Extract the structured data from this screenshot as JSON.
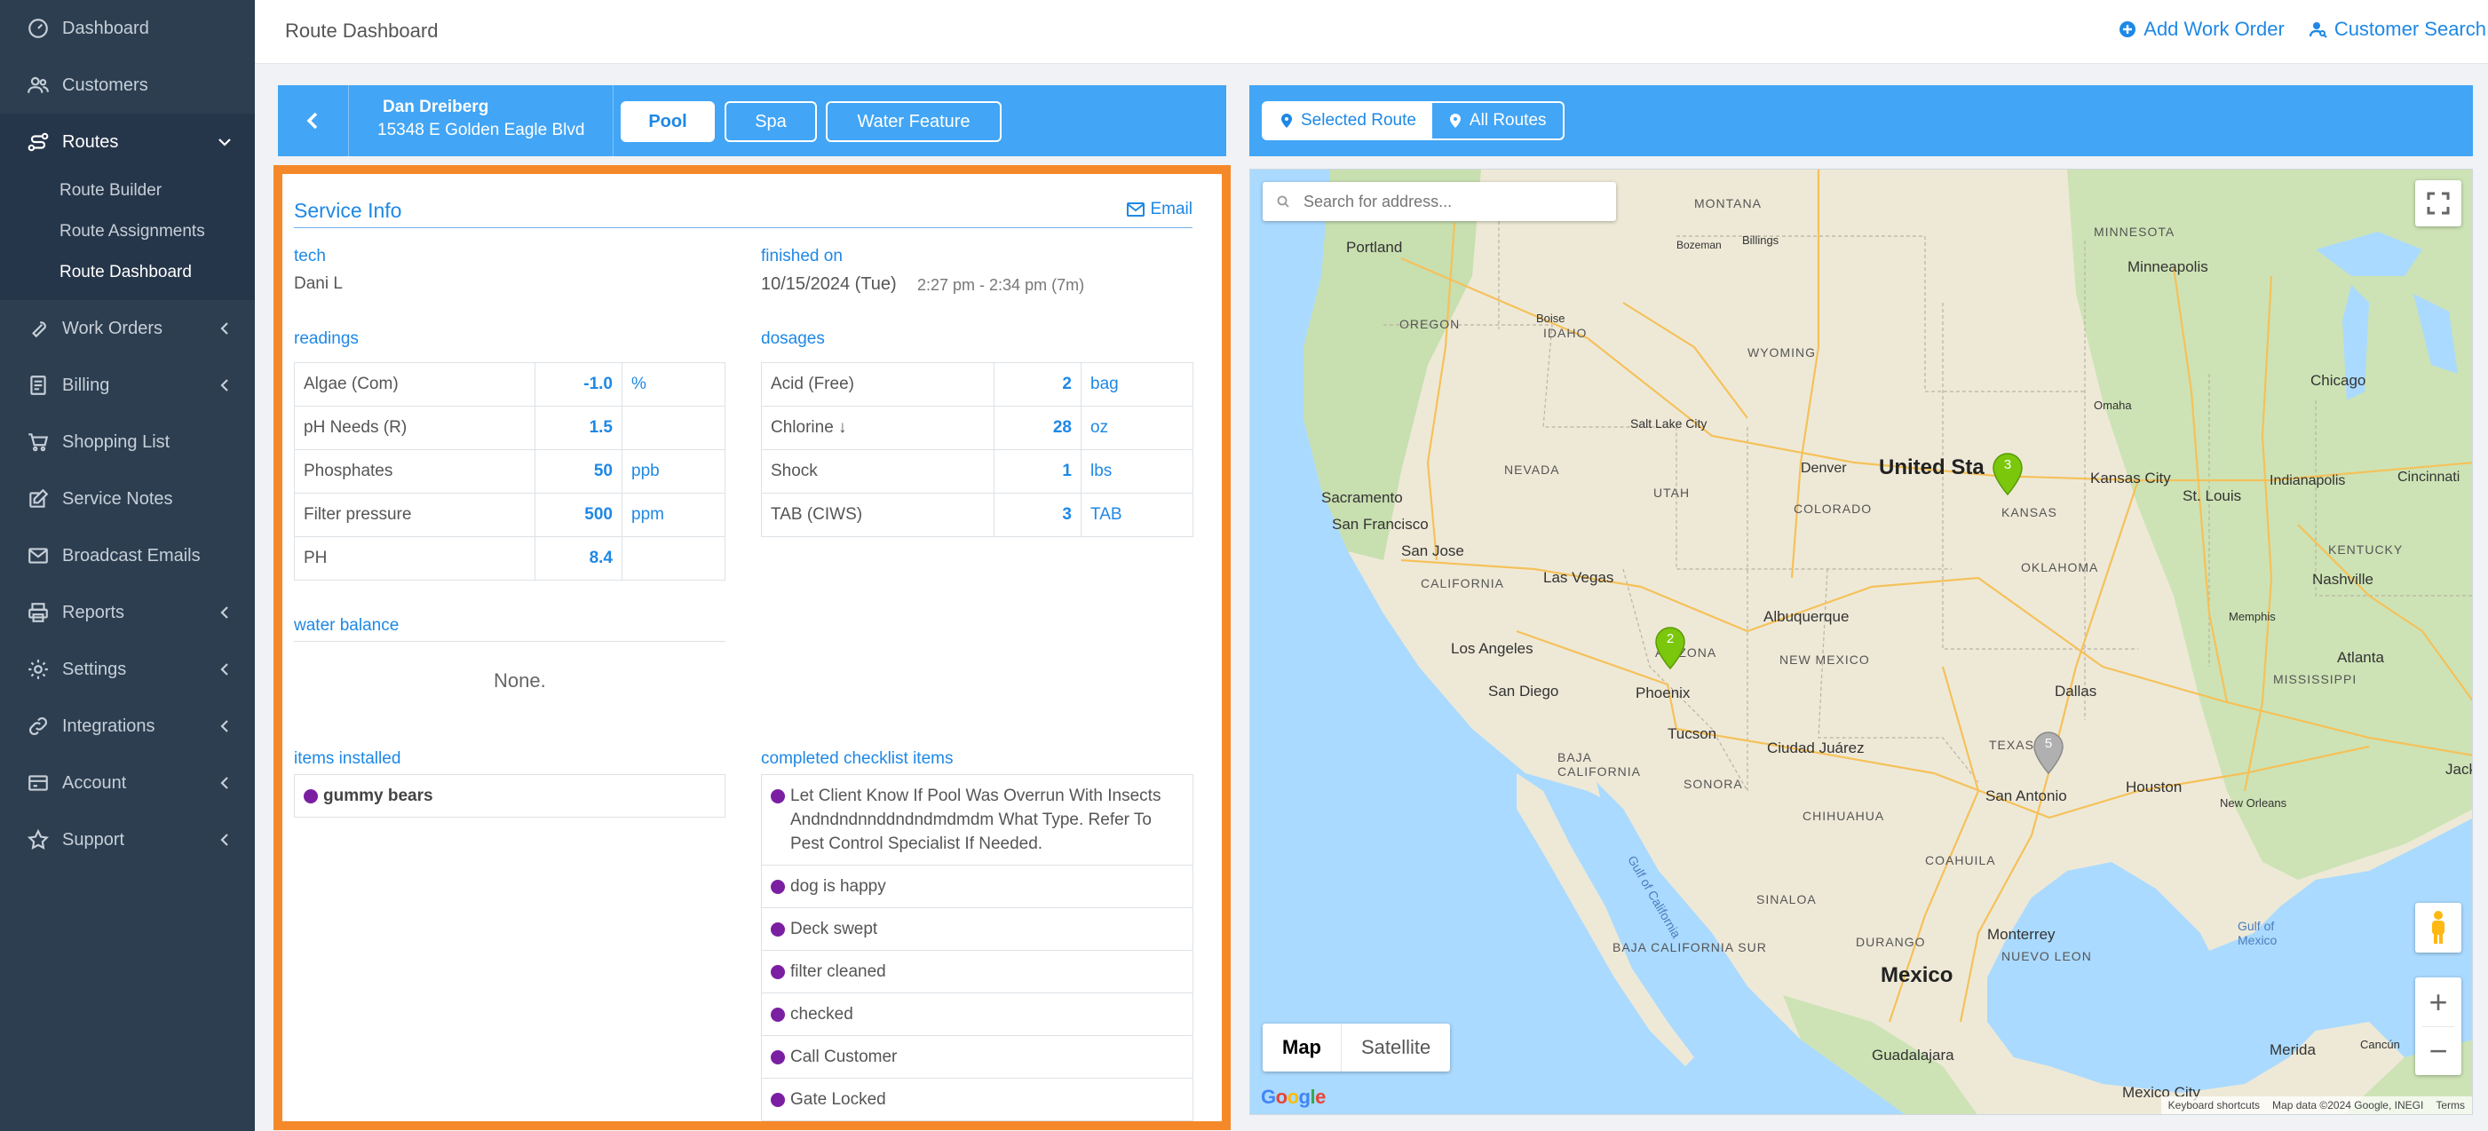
{
  "sidebar": {
    "items": [
      {
        "label": "Dashboard",
        "icon": "dashboard-icon"
      },
      {
        "label": "Customers",
        "icon": "customers-icon"
      },
      {
        "label": "Routes",
        "icon": "routes-icon"
      },
      {
        "label": "Work Orders",
        "icon": "wrench-icon"
      },
      {
        "label": "Billing",
        "icon": "billing-icon"
      },
      {
        "label": "Shopping List",
        "icon": "cart-icon"
      },
      {
        "label": "Service Notes",
        "icon": "edit-icon"
      },
      {
        "label": "Broadcast Emails",
        "icon": "envelope-icon"
      },
      {
        "label": "Reports",
        "icon": "printer-icon"
      },
      {
        "label": "Settings",
        "icon": "gear-icon"
      },
      {
        "label": "Integrations",
        "icon": "link-icon"
      },
      {
        "label": "Account",
        "icon": "account-icon"
      },
      {
        "label": "Support",
        "icon": "star-icon"
      }
    ],
    "routes_sub": [
      "Route Builder",
      "Route Assignments",
      "Route Dashboard"
    ]
  },
  "header": {
    "title": "Route Dashboard",
    "add_work_order": "Add Work Order",
    "customer_search": "Customer Search"
  },
  "customer": {
    "name": "Dan Dreiberg",
    "address": "15348 E Golden Eagle Blvd"
  },
  "body_tabs": [
    "Pool",
    "Spa",
    "Water Feature"
  ],
  "service": {
    "title": "Service Info",
    "email_label": "Email",
    "tech_label": "tech",
    "tech_value": "Dani L",
    "finished_label": "finished on",
    "finished_date": "10/15/2024 (Tue)",
    "finished_time": "2:27 pm - 2:34 pm (7m)",
    "readings_label": "readings",
    "readings": [
      {
        "name": "Algae (Com)",
        "value": "-1.0",
        "unit": "%"
      },
      {
        "name": "pH Needs (R)",
        "value": "1.5",
        "unit": ""
      },
      {
        "name": "Phosphates",
        "value": "50",
        "unit": "ppb"
      },
      {
        "name": "Filter pressure",
        "value": "500",
        "unit": "ppm"
      },
      {
        "name": "PH",
        "value": "8.4",
        "unit": ""
      }
    ],
    "dosages_label": "dosages",
    "dosages": [
      {
        "name": "Acid (Free)",
        "value": "2",
        "unit": "bag"
      },
      {
        "name": "Chlorine ↓",
        "value": "28",
        "unit": "oz"
      },
      {
        "name": "Shock",
        "value": "1",
        "unit": "lbs"
      },
      {
        "name": "TAB (CIWS)",
        "value": "3",
        "unit": "TAB"
      }
    ],
    "water_balance_label": "water balance",
    "water_balance_value": "None.",
    "items_installed_label": "items installed",
    "items_installed": [
      "gummy bears"
    ],
    "checklist_label": "completed checklist items",
    "checklist": [
      "Let Client Know If Pool Was Overrun With Insects Andndndnnddndndmdmdm What Type. Refer To Pest Control Specialist If Needed.",
      "dog is happy",
      "Deck swept",
      "filter cleaned",
      "checked",
      "Call Customer",
      "Gate Locked"
    ],
    "dot_color": "#7b1fa2"
  },
  "map_panel": {
    "tabs": [
      "Selected Route",
      "All Routes"
    ],
    "search_placeholder": "Search for address...",
    "map_type": [
      "Map",
      "Satellite"
    ],
    "google_logo": "Google",
    "attribution": [
      "Keyboard shortcuts",
      "Map data ©2024 Google, INEGI",
      "Terms"
    ],
    "markers": [
      {
        "label": "3",
        "color": "#7ac70c"
      },
      {
        "label": "2",
        "color": "#7ac70c"
      },
      {
        "label": "5",
        "color": "#b0b0b0"
      }
    ],
    "labels": {
      "montana": "MONTANA",
      "portland": "Portland",
      "billings": "Billings",
      "bozeman": "Bozeman",
      "minnesota": "MINNESOTA",
      "minneapolis": "Minneapolis",
      "oregon": "OREGON",
      "boise": "Boise",
      "idaho": "IDAHO",
      "wyoming": "WYOMING",
      "chicago": "Chicago",
      "omaha": "Omaha",
      "salt_lake": "Salt Lake City",
      "nevada": "NEVADA",
      "utah": "UTAH",
      "denver": "Denver",
      "united_states": "United Sta",
      "kansas_city": "Kansas City",
      "indianapolis": "Indianapolis",
      "cincinnati": "Cincinnati",
      "sacramento": "Sacramento",
      "san_francisco": "San Francisco",
      "colorado": "COLORADO",
      "kansas": "KANSAS",
      "st_louis": "St. Louis",
      "san_jose": "San Jose",
      "kentucky": "KENTUCKY",
      "california": "CALIFORNIA",
      "las_vegas": "Las Vegas",
      "nashville": "Nashville",
      "oklahoma": "OKLAHOMA",
      "memphis": "Memphis",
      "albuquerque": "Albuquerque",
      "los_angeles": "Los Angeles",
      "arizona": "ARIZONA",
      "new_mexico": "NEW MEXICO",
      "atlanta": "Atlanta",
      "san_diego": "San Diego",
      "phoenix": "Phoenix",
      "dallas": "Dallas",
      "mississippi": "MISSISSIPPI",
      "tucson": "Tucson",
      "ciudad_juarez": "Ciudad Juárez",
      "baja_california": "BAJA CALIFORNIA",
      "texas": "TEXAS",
      "jack": "Jack",
      "sonora": "SONORA",
      "san_antonio": "San Antonio",
      "houston": "Houston",
      "new_orleans": "New Orleans",
      "chihuahua": "CHIHUAHUA",
      "coahuila": "COAHUILA",
      "gulf_california": "Gulf of California",
      "gulf_mexico": "Gulf of Mexico",
      "monterrey": "Monterrey",
      "nuevo_leon": "NUEVO LEON",
      "sinaloa": "SINALOA",
      "baja_sur": "BAJA CALIFORNIA SUR",
      "durango": "DURANGO",
      "mexico": "Mexico",
      "guadalajara": "Guadalajara",
      "merida": "Merida",
      "cancun": "Cancún",
      "mexico_city": "Mexico City"
    }
  }
}
